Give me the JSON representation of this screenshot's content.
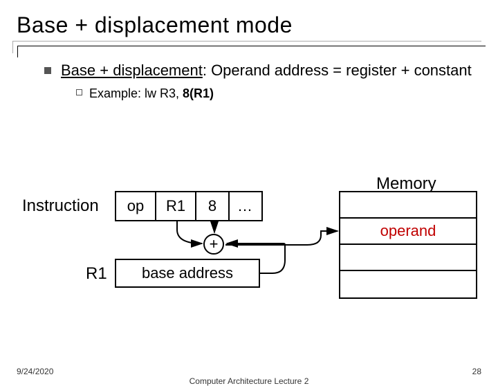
{
  "title": "Base + displacement mode",
  "bullet": {
    "term": "Base + displacement",
    "definition": ": Operand address = register + constant",
    "example_label": "Example:  lw R3, ",
    "example_bold": "8(R1)"
  },
  "diagram": {
    "memory_label": "Memory",
    "instruction_label": "Instruction",
    "cells": {
      "op": "op",
      "r1": "R1",
      "eight": "8",
      "dots": "…"
    },
    "plus": "+",
    "register_label": "R1",
    "register_value": "base address",
    "memory_rows": [
      "",
      "operand",
      "",
      ""
    ]
  },
  "footer": {
    "date": "9/24/2020",
    "center": "Computer Architecture Lecture 2",
    "page": "28"
  }
}
